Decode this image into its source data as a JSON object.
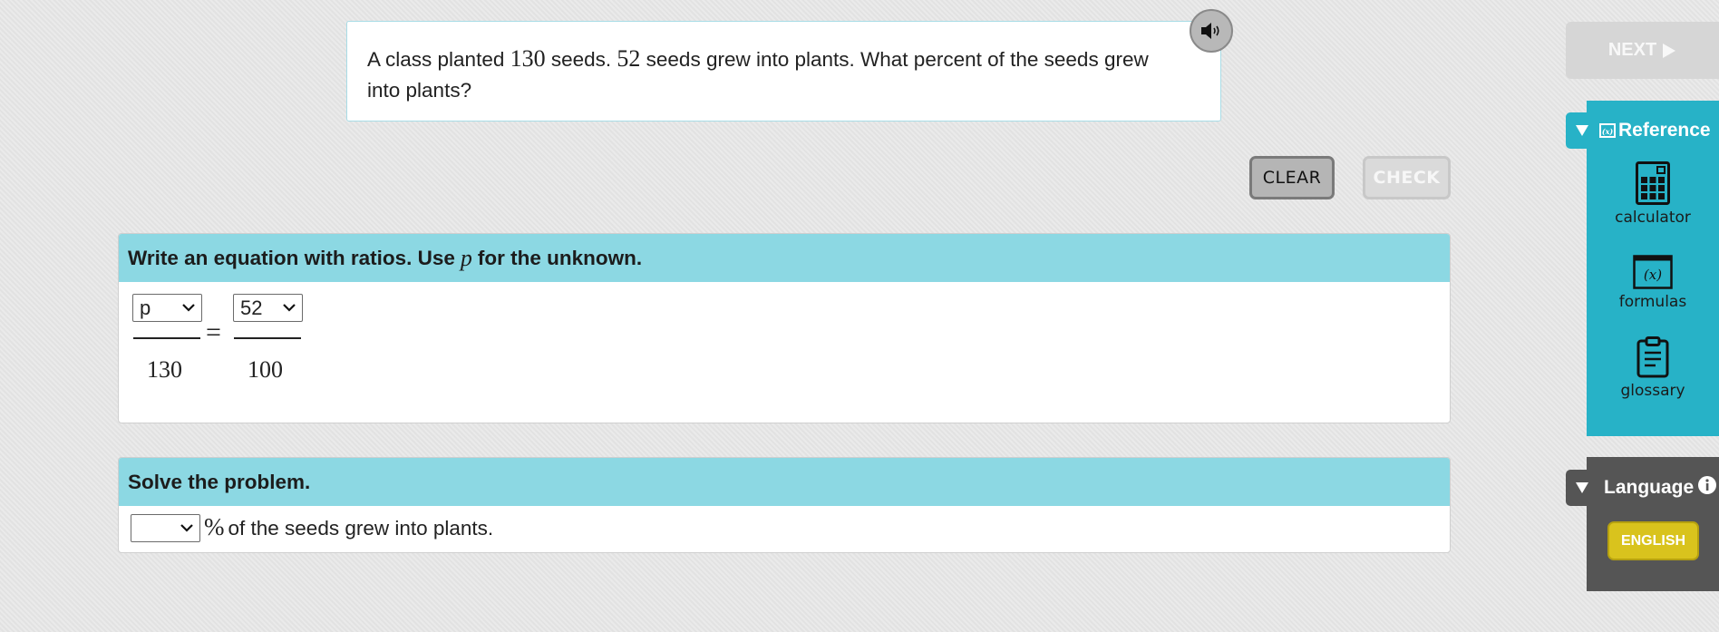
{
  "question": {
    "text_1": "A class planted ",
    "num_1": "130",
    "text_2": " seeds. ",
    "num_2": "52",
    "text_3": " seeds grew into plants. What percent of the seeds grew into plants?"
  },
  "actions": {
    "clear_label": "CLEAR",
    "check_label": "CHECK"
  },
  "equation_panel": {
    "header_prefix": "Write an equation with ratios. Use ",
    "header_var": "p",
    "header_suffix": " for the unknown.",
    "left_numerator_selected": "p",
    "left_denominator": "130",
    "equals": "=",
    "right_numerator_selected": "52",
    "right_denominator": "100"
  },
  "solve_panel": {
    "header": "Solve the problem.",
    "answer_selected": "",
    "percent_symbol": "%",
    "sentence": " of the seeds grew into plants."
  },
  "sidebar": {
    "next_label": "NEXT",
    "reference": {
      "tab_label": "Reference",
      "tools": [
        {
          "label": "calculator",
          "icon": "calculator-icon"
        },
        {
          "label": "formulas",
          "icon": "formulas-icon"
        },
        {
          "label": "glossary",
          "icon": "glossary-icon"
        }
      ]
    },
    "language": {
      "tab_label": "Language",
      "english_label": "ENGLISH"
    }
  },
  "colors": {
    "panel_header": "#8cd8e3",
    "reference_panel": "#27b2c7",
    "language_panel": "#555555",
    "english_button": "#d9c31d"
  }
}
